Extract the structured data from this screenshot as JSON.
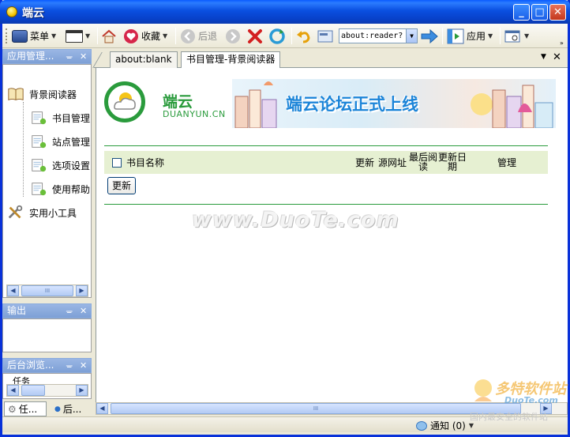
{
  "window": {
    "title": "端云",
    "min_label": "_",
    "max_label": "□",
    "close_label": "✕"
  },
  "toolbar": {
    "menu_label": "菜单",
    "favorites_label": "收藏",
    "back_label": "后退",
    "url_value": "about:reader?",
    "apps_label": "应用"
  },
  "left_panel": {
    "title": "应用管理...",
    "tree": [
      {
        "label": "背景阅读器",
        "icon": "book-icon"
      },
      {
        "label": "书目管理",
        "icon": "page-gear-icon"
      },
      {
        "label": "站点管理",
        "icon": "page-gear-icon"
      },
      {
        "label": "选项设置",
        "icon": "page-gear-icon"
      },
      {
        "label": "使用帮助",
        "icon": "page-gear-icon"
      },
      {
        "label": "实用小工具",
        "icon": "tools-icon"
      }
    ],
    "scroll_grip": "III"
  },
  "output_panel": {
    "title": "输出"
  },
  "bg_panel": {
    "title": "后台浏览...",
    "item": "任务"
  },
  "bottom_tabs": [
    {
      "label": "任..."
    },
    {
      "label": "后..."
    }
  ],
  "tabs": [
    {
      "label": "about:blank"
    },
    {
      "label": "书目管理-背景阅读器"
    }
  ],
  "page": {
    "logo_cn": "端云",
    "logo_en": "DUANYUN.CN",
    "banner_text": "端云论坛正式上线",
    "columns": {
      "name": "书目名称",
      "update": "更新",
      "source": "源网址",
      "last_read_1": "最后阅",
      "last_read_2": "读",
      "update_date_1": "更新日",
      "update_date_2": "期",
      "manage": "管理"
    },
    "refresh_button": "更新",
    "watermark": "www.DuoTe.com"
  },
  "status": {
    "notify_label": "通知 (0)"
  },
  "stamp": {
    "title": "多特软件站",
    "site": "DuoTe.com",
    "slogan": "国内最安全的软件站"
  },
  "colors": {
    "accent_green": "#2a9b3c",
    "title_blue": "#0a4fe0",
    "banner_blue": "#1b84d8"
  }
}
